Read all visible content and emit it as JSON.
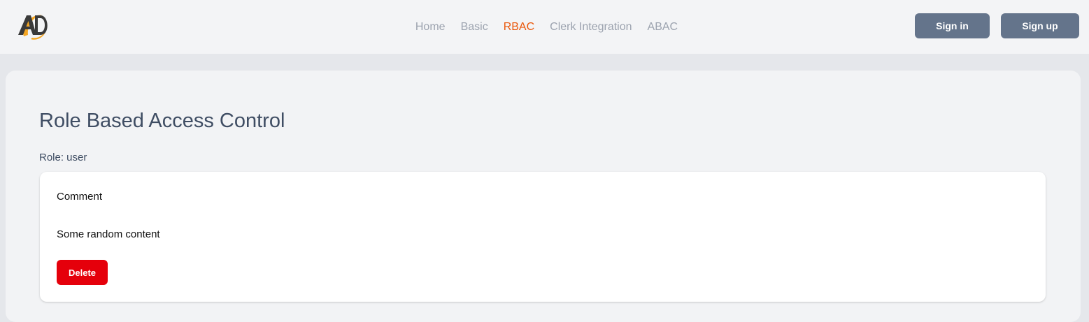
{
  "nav": {
    "logo_icon": "ad-logo-icon",
    "links": [
      {
        "label": "Home",
        "active": false
      },
      {
        "label": "Basic",
        "active": false
      },
      {
        "label": "RBAC",
        "active": true
      },
      {
        "label": "Clerk Integration",
        "active": false
      },
      {
        "label": "ABAC",
        "active": false
      }
    ],
    "signin_label": "Sign in",
    "signup_label": "Sign up"
  },
  "main": {
    "title": "Role Based Access Control",
    "role_text": "Role: user",
    "card": {
      "title": "Comment",
      "content": "Some random content",
      "delete_label": "Delete"
    }
  },
  "colors": {
    "accent": "#ea580c",
    "nav_link": "#9ca3af",
    "auth_button": "#64748b",
    "delete_button": "#e5000b",
    "heading": "#3f4d63"
  }
}
